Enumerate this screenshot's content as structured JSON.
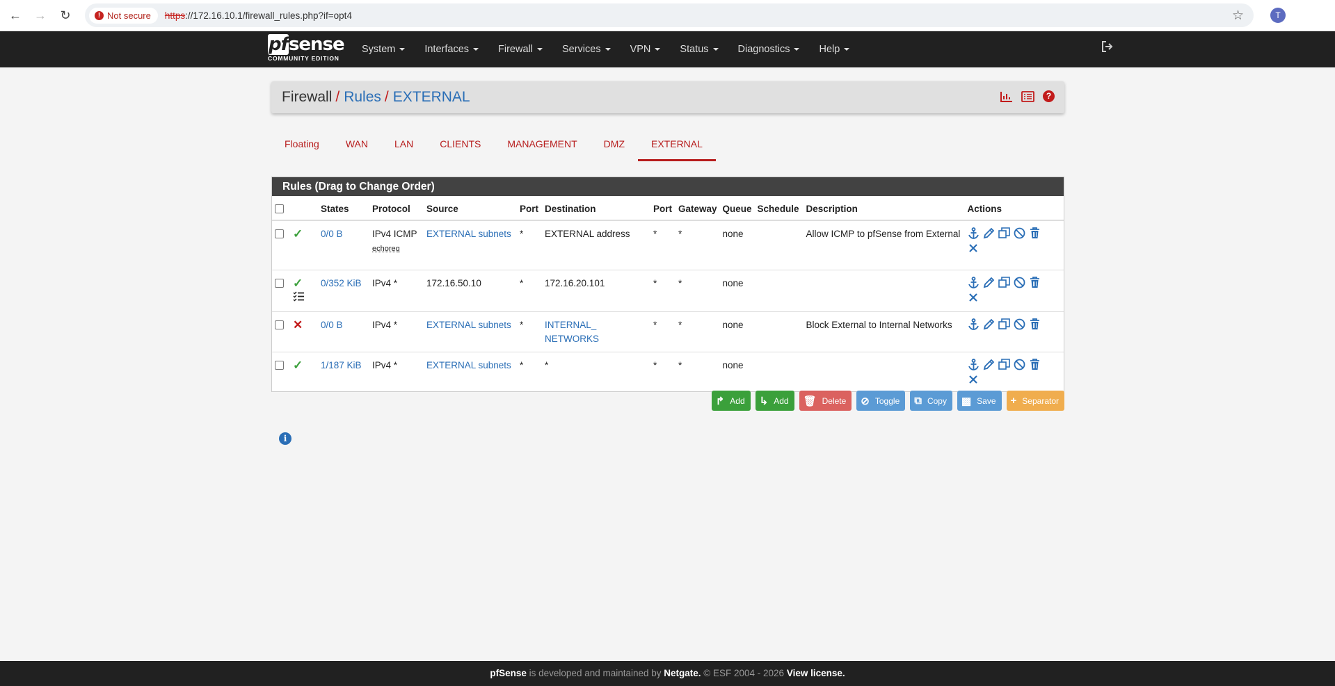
{
  "browser": {
    "security_label": "Not secure",
    "url_scheme": "https",
    "url_rest": "://172.16.10.1/firewall_rules.php?if=opt4",
    "profile_initial": "T"
  },
  "navbar": {
    "logo_text": "sense",
    "logo_pf": "pf",
    "logo_sub": "COMMUNITY EDITION",
    "menu": [
      "System",
      "Interfaces",
      "Firewall",
      "Services",
      "VPN",
      "Status",
      "Diagnostics",
      "Help"
    ]
  },
  "breadcrumb": {
    "root": "Firewall",
    "section": "Rules",
    "current": "EXTERNAL",
    "help_glyph": "?"
  },
  "tabs": [
    "Floating",
    "WAN",
    "LAN",
    "CLIENTS",
    "MANAGEMENT",
    "DMZ",
    "EXTERNAL"
  ],
  "panel": {
    "title": "Rules (Drag to Change Order)",
    "headers": [
      "States",
      "Protocol",
      "Source",
      "Port",
      "Destination",
      "Port",
      "Gateway",
      "Queue",
      "Schedule",
      "Description",
      "Actions"
    ],
    "rows": [
      {
        "status": "pass",
        "states": "0/0 B",
        "protocol": "IPv4 ICMP",
        "protocol_sub": "echoreq",
        "source": "EXTERNAL subnets",
        "sport": "*",
        "destination": "EXTERNAL address",
        "dest_link": false,
        "dport": "*",
        "gateway": "*",
        "queue": "none",
        "schedule": "",
        "description": "Allow ICMP to pfSense from External"
      },
      {
        "status": "pass",
        "states": "0/352 KiB",
        "protocol": "IPv4 *",
        "protocol_sub": "",
        "source": "172.16.50.10",
        "sport": "*",
        "destination": "172.16.20.101",
        "dest_link": false,
        "dport": "*",
        "gateway": "*",
        "queue": "none",
        "schedule": "",
        "description": ""
      },
      {
        "status": "block",
        "states": "0/0 B",
        "protocol": "IPv4 *",
        "protocol_sub": "",
        "source": "EXTERNAL subnets",
        "sport": "*",
        "destination": "INTERNAL_ NETWORKS",
        "dest_link": true,
        "dport": "*",
        "gateway": "*",
        "queue": "none",
        "schedule": "",
        "description": "Block External to Internal Networks"
      },
      {
        "status": "pass",
        "states": "1/187 KiB",
        "protocol": "IPv4 *",
        "protocol_sub": "",
        "source": "EXTERNAL subnets",
        "sport": "*",
        "destination": "*",
        "dest_link": false,
        "dport": "*",
        "gateway": "*",
        "queue": "none",
        "schedule": "",
        "description": ""
      }
    ]
  },
  "buttons": {
    "add_top": "Add",
    "add_bottom": "Add",
    "delete": "Delete",
    "toggle": "Toggle",
    "copy": "Copy",
    "save": "Save",
    "separator": "Separator"
  },
  "info_glyph": "i",
  "footer": {
    "brand": "pfSense",
    "text1": " is developed and maintained by ",
    "company": "Netgate.",
    "text2": " © ESF 2004 - 2026 ",
    "license": "View license."
  },
  "colors": {
    "navbar": "#212121",
    "accent_red": "#b71c1c",
    "link_blue": "#2a6eb6",
    "pass_green": "#3ca03c"
  }
}
